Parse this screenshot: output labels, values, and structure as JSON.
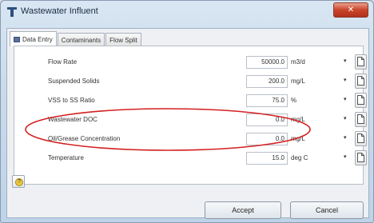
{
  "window": {
    "title": "Wastewater Influent",
    "close_glyph": "✕"
  },
  "tabs": [
    {
      "label": "Data Entry",
      "active": true,
      "icon": "grid-icon"
    },
    {
      "label": "Contaminants",
      "active": false
    },
    {
      "label": "Flow Split",
      "active": false
    }
  ],
  "rows": [
    {
      "label": "Flow Rate",
      "value": "50000.0",
      "unit": "m3/d"
    },
    {
      "label": "Suspended Solids",
      "value": "200.0",
      "unit": "mg/L"
    },
    {
      "label": "VSS to SS Ratio",
      "value": "75.0",
      "unit": "%"
    },
    {
      "label": "Wastewater DOC",
      "value": "0.0",
      "unit": "mg/L"
    },
    {
      "label": "Oil/Grease Concentration",
      "value": "0.0",
      "unit": "mg/L"
    },
    {
      "label": "Temperature",
      "value": "15.0",
      "unit": "deg C"
    }
  ],
  "row_dropdown_glyph": "▾",
  "footer": {
    "help_glyph": "?",
    "accept_label": "Accept",
    "cancel_label": "Cancel"
  },
  "annotation": {
    "color": "#d42020",
    "target_row": "Wastewater DOC"
  },
  "colors": {
    "accent": "#5a6f9a",
    "window_bg": "#c9dbec"
  }
}
